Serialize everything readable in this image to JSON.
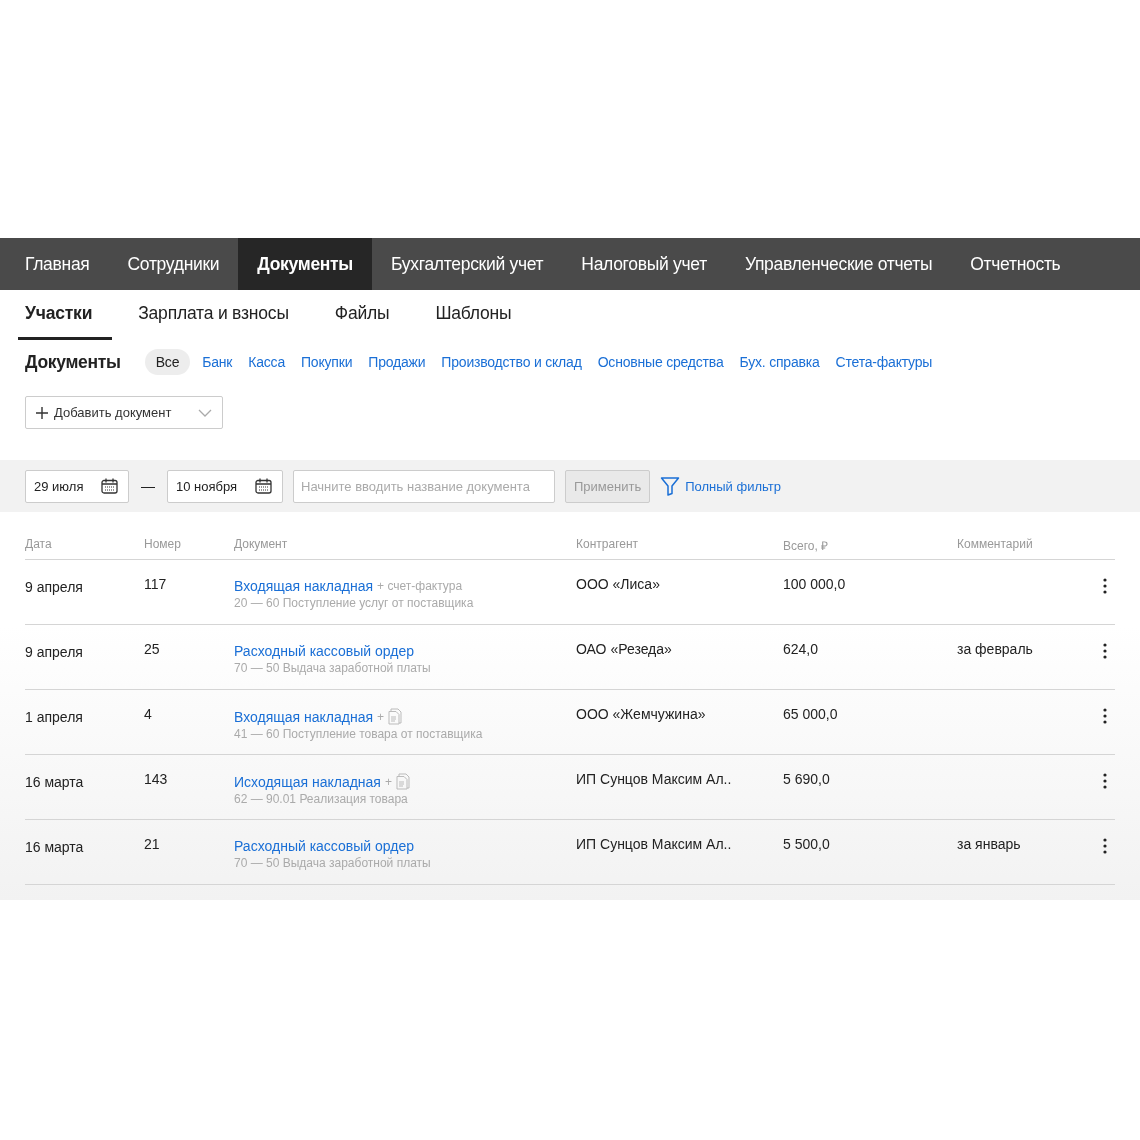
{
  "nav": [
    {
      "label": "Главная",
      "selected": false
    },
    {
      "label": "Сотрудники",
      "selected": false
    },
    {
      "label": "Документы",
      "selected": true
    },
    {
      "label": "Бухгалтерский учет",
      "selected": false
    },
    {
      "label": "Налоговый учет",
      "selected": false
    },
    {
      "label": "Управленческие отчеты",
      "selected": false
    },
    {
      "label": "Отчетность",
      "selected": false
    }
  ],
  "subtabs": [
    {
      "label": "Участки",
      "selected": true
    },
    {
      "label": "Зарплата и взносы",
      "selected": false
    },
    {
      "label": "Файлы",
      "selected": false
    },
    {
      "label": "Шаблоны",
      "selected": false
    }
  ],
  "section_title": "Документы",
  "categories": [
    {
      "label": "Все",
      "selected": true
    },
    {
      "label": "Банк",
      "selected": false
    },
    {
      "label": "Касса",
      "selected": false
    },
    {
      "label": "Покупки",
      "selected": false
    },
    {
      "label": "Продажи",
      "selected": false
    },
    {
      "label": "Производство и склад",
      "selected": false
    },
    {
      "label": "Основные средства",
      "selected": false
    },
    {
      "label": "Бух. справка",
      "selected": false
    },
    {
      "label": "Стета-фактуры",
      "selected": false
    }
  ],
  "add_button": "Добавить документ",
  "filter": {
    "date_from": "29 июля",
    "separator": "—",
    "date_to": "10 ноября",
    "search_placeholder": "Начните вводить название документа",
    "apply_button": "Применить",
    "apply_disabled": true,
    "full_filter": "Полный фильтр"
  },
  "table": {
    "columns": [
      "Дата",
      "Номер",
      "Документ",
      "Контрагент",
      "Всего, ₽",
      "Комментарий"
    ],
    "rows": [
      {
        "date": "9 апреля",
        "number": "117",
        "document": "Входящая накладная",
        "extra": {
          "kind": "text",
          "text": "+ счет-фактура"
        },
        "entry": "20 — 60 Поступление услуг от поставщика",
        "counterparty": "ООО «Лиса»",
        "total": "100 000,0"
      },
      {
        "date": "9 апреля",
        "number": "25",
        "document": "Расходный кассовый ордер",
        "entry": "70 — 50 Выдача заработной платы",
        "counterparty": "ОАО «Резеда»",
        "total": "624,0",
        "comment": "за февраль"
      },
      {
        "date": "1 апреля",
        "number": "4",
        "document": "Входящая накладная",
        "extra": {
          "kind": "icon",
          "text": "+"
        },
        "entry": "41 — 60 Поступление товара от поставщика",
        "counterparty": "ООО «Жемчужина»",
        "total": "65 000,0"
      },
      {
        "date": "16 марта",
        "number": "143",
        "document": "Исходящая накладная",
        "extra": {
          "kind": "icon",
          "text": "+"
        },
        "entry": "62 — 90.01 Реализация товара",
        "counterparty": "ИП Сунцов Максим Ал..",
        "total": "5 690,0"
      },
      {
        "date": "16 марта",
        "number": "21",
        "document": "Расходный кассовый ордер",
        "entry": "70 — 50 Выдача заработной платы",
        "counterparty": "ИП Сунцов Максим Ал..",
        "total": "5 500,0",
        "comment": "за январь"
      }
    ]
  }
}
